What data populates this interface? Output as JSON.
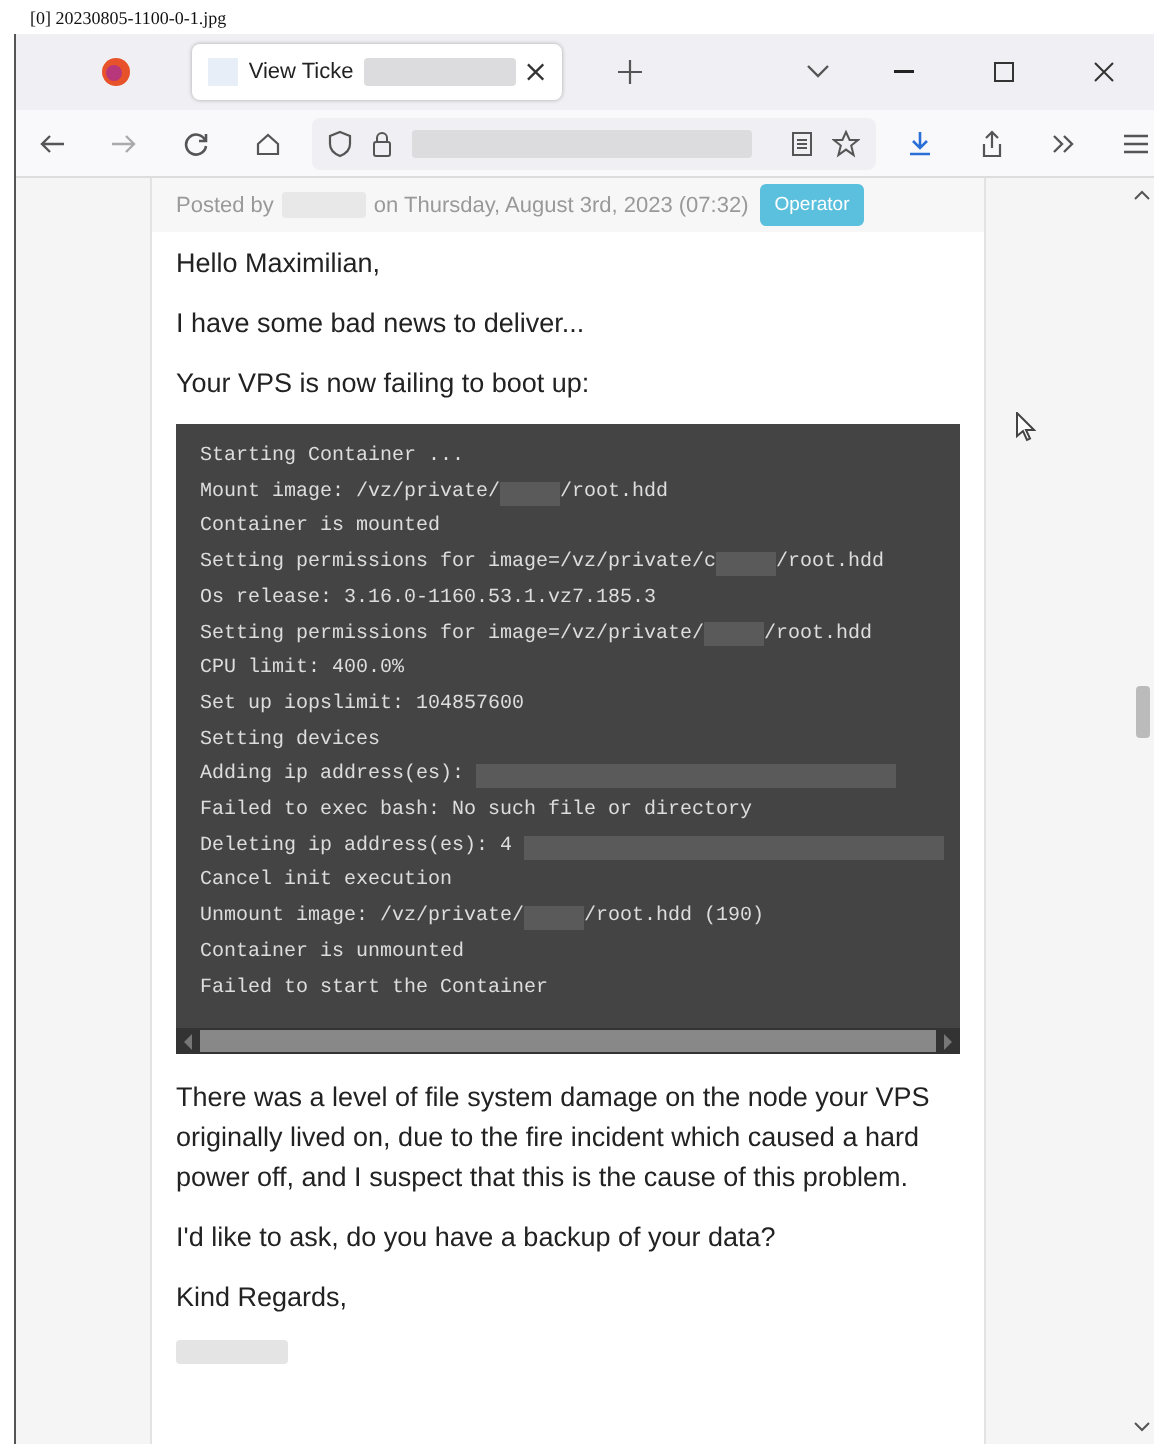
{
  "file_label": "[0] 20230805-1100-0-1.jpg",
  "tabs": [
    {
      "title": "View Ticke",
      "title_redacted": true,
      "selected": true
    }
  ],
  "address_bar": {
    "redacted": true
  },
  "post": {
    "posted_prefix": "Posted by",
    "author_redacted": true,
    "posted_date": "on Thursday, August 3rd, 2023 (07:32)",
    "badge": "Operator",
    "paragraphs_before": [
      "Hello Maximilian,",
      "I have some bad news to deliver...",
      "Your VPS is now failing to boot up:"
    ],
    "terminal_lines": [
      {
        "before": "Starting Container ...",
        "redacted": false
      },
      {
        "before": "Mount image: /vz/private/",
        "redacted": true,
        "after": "/root.hdd"
      },
      {
        "before": "Container is mounted",
        "redacted": false
      },
      {
        "before": "Setting permissions for image=/vz/private/c",
        "redacted": true,
        "after": "/root.hdd"
      },
      {
        "before": "Os release: 3.16.0-1160.53.1.vz7.185.3",
        "redacted": false
      },
      {
        "before": "Setting permissions for image=/vz/private/",
        "redacted": true,
        "after": "/root.hdd"
      },
      {
        "before": "CPU limit: 400.0%",
        "redacted": false
      },
      {
        "before": "Set up iopslimit: 104857600",
        "redacted": false
      },
      {
        "before": "Setting devices",
        "redacted": false
      },
      {
        "before": "Adding ip address(es):",
        "redacted": true
      },
      {
        "before": "Failed to exec bash: No such file or directory",
        "redacted": false
      },
      {
        "before": "Deleting ip address(es): 4",
        "redacted": true
      },
      {
        "before": "Cancel init execution",
        "redacted": false
      },
      {
        "before": "Unmount image: /vz/private/",
        "redacted": true,
        "after": "/root.hdd (190)"
      },
      {
        "before": "Container is unmounted",
        "redacted": false
      },
      {
        "before": "Failed to start the Container",
        "redacted": false
      }
    ],
    "paragraphs_after": [
      "There was a level of file system damage on the node your VPS originally lived on, due to the fire incident which caused a hard power off, and I suspect that this is the cause of this problem.",
      "I'd like to ask, do you have a backup of your data?",
      "Kind Regards,"
    ],
    "signature_redacted": true
  }
}
